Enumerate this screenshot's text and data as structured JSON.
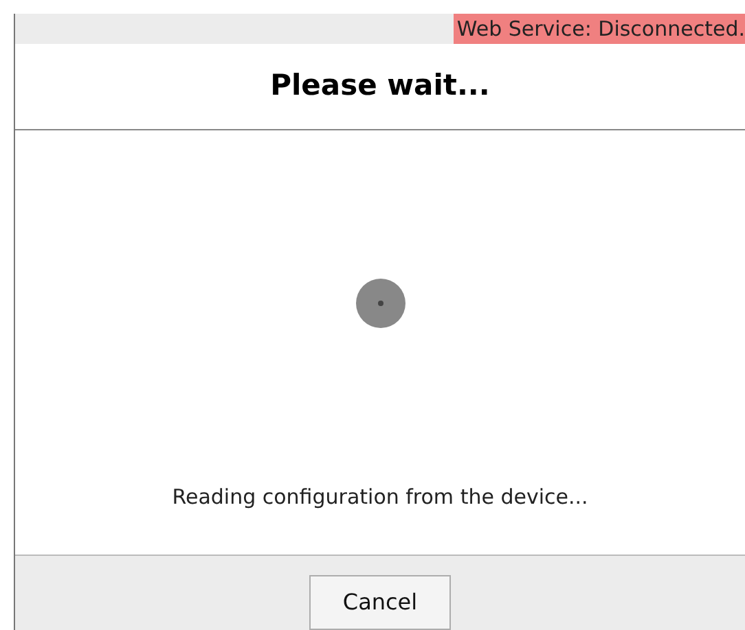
{
  "status_bar": {
    "text": "Web Service: Disconnected.",
    "connected": false
  },
  "dialog": {
    "title": "Please wait...",
    "message": "Reading configuration from the device...",
    "buttons": [
      "Cancel"
    ]
  }
}
